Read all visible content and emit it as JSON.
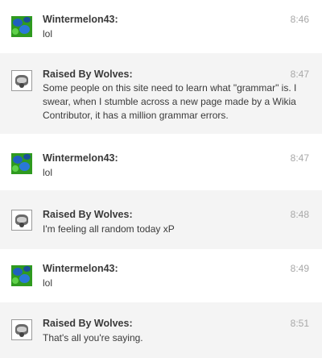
{
  "messages": [
    {
      "user": "Wintermelon43:",
      "time": "8:46",
      "text": "lol",
      "avatar": "green-blue-avatar"
    },
    {
      "user": "Raised By Wolves:",
      "time": "8:47",
      "text": "Some people on this site need to learn what \"grammar\" is. I swear, when I stumble across a new page made by a Wikia Contributor, it has a million grammar errors.",
      "avatar": "wolf-avatar"
    },
    {
      "user": "Wintermelon43:",
      "time": "8:47",
      "text": "lol",
      "avatar": "green-blue-avatar"
    },
    {
      "user": "Raised By Wolves:",
      "time": "8:48",
      "text": "I'm feeling all random today xP",
      "avatar": "wolf-avatar"
    },
    {
      "user": "Wintermelon43:",
      "time": "8:49",
      "text": "lol",
      "avatar": "green-blue-avatar"
    },
    {
      "user": "Raised By Wolves:",
      "time": "8:51",
      "text": "That's all you're saying.",
      "avatar": "wolf-avatar"
    }
  ]
}
